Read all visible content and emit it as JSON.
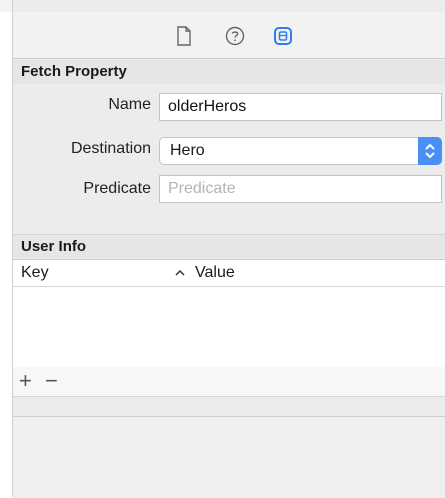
{
  "toolbar": {
    "icons": [
      "file-icon",
      "help-icon",
      "data-model-inspector-icon"
    ],
    "accent": "#2f7cf6"
  },
  "fetch_property": {
    "header": "Fetch Property",
    "name_label": "Name",
    "name_value": "olderHeros",
    "destination_label": "Destination",
    "destination_value": "Hero",
    "predicate_label": "Predicate",
    "predicate_placeholder": "Predicate"
  },
  "user_info": {
    "header": "User Info",
    "columns": [
      "Key",
      "Value"
    ],
    "rows": [],
    "add_label": "+",
    "remove_label": "−"
  },
  "colors": {
    "select_stepper": "#4a8ff5",
    "panel_bg": "#ececec"
  }
}
